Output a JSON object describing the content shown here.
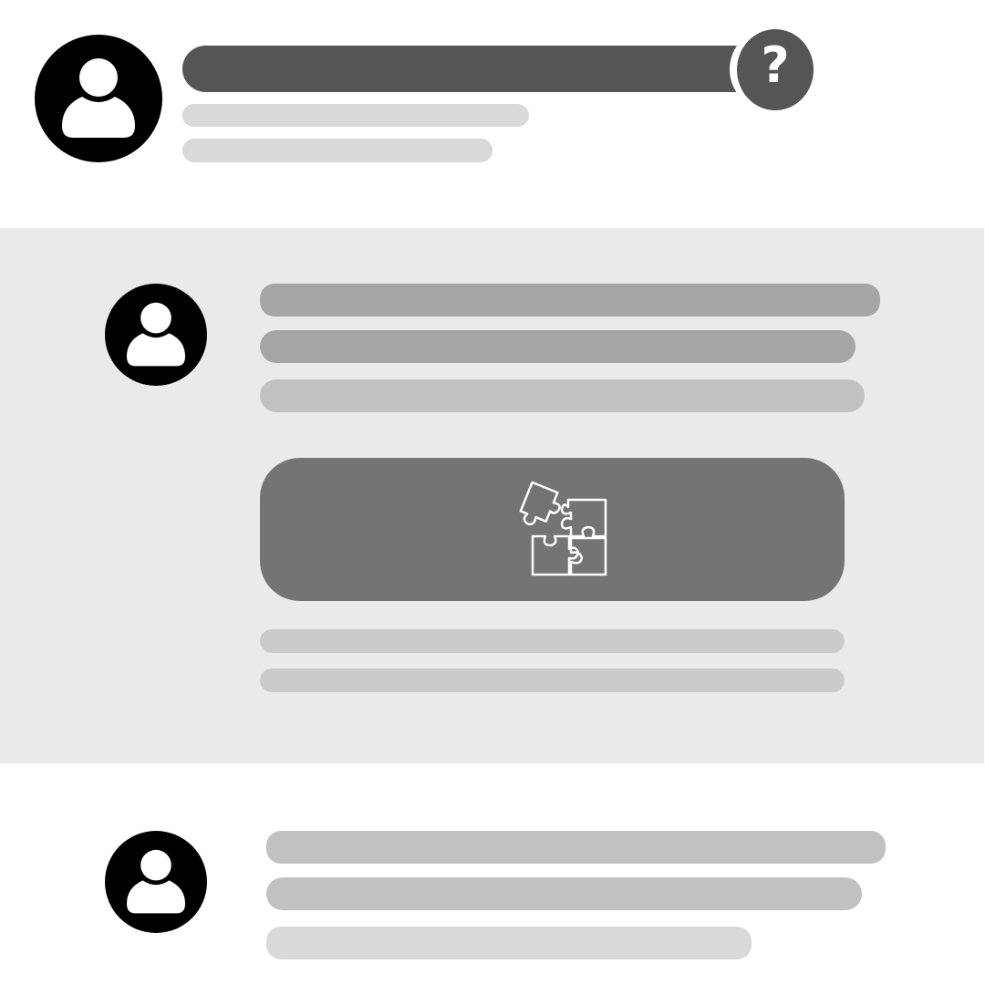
{
  "colors": {
    "background": "#ffffff",
    "panel": "#eaeaea",
    "avatar": "#000000",
    "header_bar": "#555555",
    "placeholder_dark": "#a5a5a5",
    "placeholder_mid": "#c1c1c1",
    "placeholder_light": "#d9d9d9",
    "card": "#747474",
    "icon_stroke": "#ffffff"
  },
  "icons": {
    "question": "question-mark-icon",
    "user": "user-icon",
    "puzzle": "puzzle-pieces-icon"
  },
  "question_mark_glyph": "?"
}
